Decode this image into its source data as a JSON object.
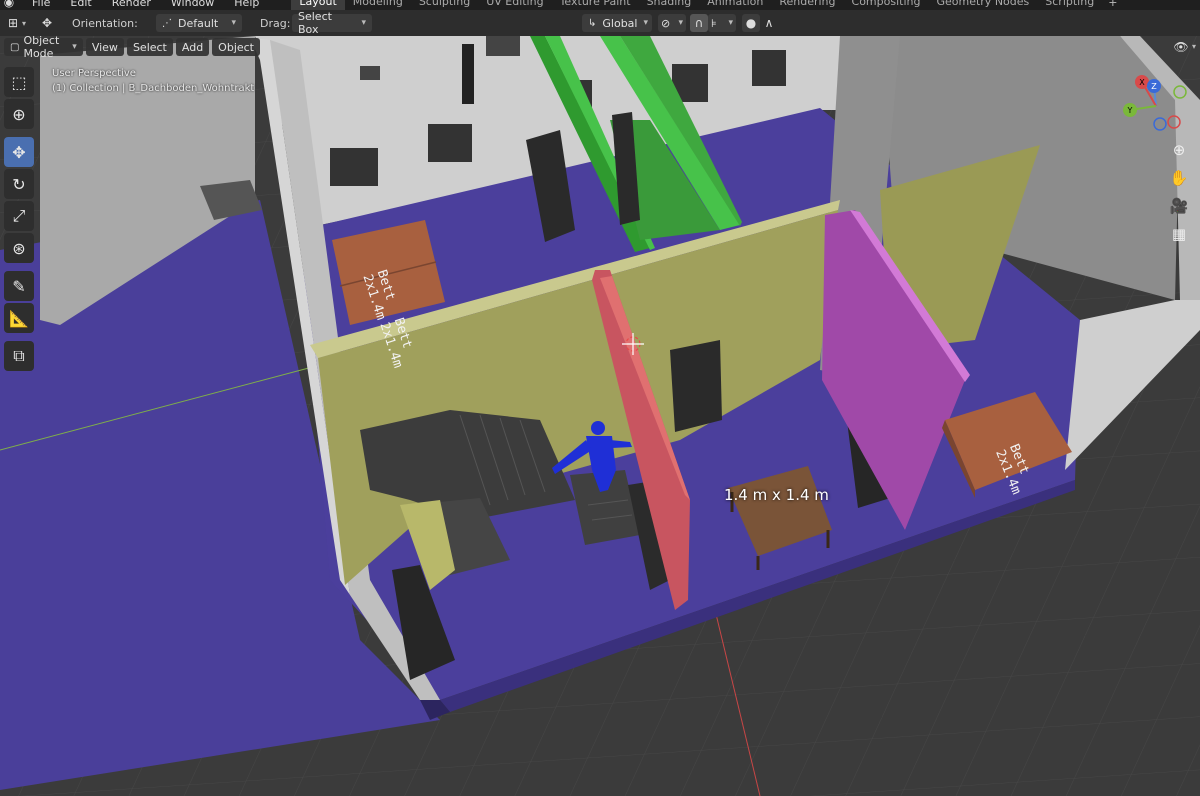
{
  "topbar": {
    "logo_icon": "blender-logo-icon",
    "menus": [
      "File",
      "Edit",
      "Render",
      "Window",
      "Help"
    ],
    "workspaces": [
      "Layout",
      "Modeling",
      "Sculpting",
      "UV Editing",
      "Texture Paint",
      "Shading",
      "Animation",
      "Rendering",
      "Compositing",
      "Geometry Nodes",
      "Scripting"
    ],
    "active_workspace": "Layout",
    "add_label": "+"
  },
  "toolbar": {
    "orientation_label": "Orientation:",
    "orientation_value": "Default",
    "drag_label": "Drag:",
    "drag_value": "Select Box",
    "transform_orientation_value": "Global"
  },
  "viewport_header": {
    "mode": "Object Mode",
    "menus": [
      "View",
      "Select",
      "Add",
      "Object"
    ]
  },
  "overlay": {
    "perspective": "User Perspective",
    "collection": "(1) Collection | B_Dachboden_Wohntrakt"
  },
  "scene": {
    "dimension_text": "1.4 m x 1.4 m",
    "bed_labels": [
      {
        "line1": "Bett",
        "line2": "2x1.4m"
      },
      {
        "line1": "Bett",
        "line2": "2x1.4m"
      },
      {
        "line1": "Bett",
        "line2": "2x1.4m"
      }
    ],
    "colors": {
      "floor": "#4a3f9a",
      "grid_bg": "#3b3b3b",
      "green_wall": "#3fa83f",
      "yellow_wall": "#9a9a55",
      "red_wall": "#c85560",
      "magenta_wall": "#a049a8",
      "bed": "#a8603f",
      "table": "#7a5438",
      "figure": "#1f2fd6",
      "white_wall": "#cfcfcf"
    }
  },
  "gizmo": {
    "x": "X",
    "y": "Y",
    "z": "Z"
  },
  "tools": [
    "select-box-icon",
    "cursor-icon",
    "move-icon",
    "rotate-icon",
    "scale-icon",
    "transform-icon",
    "annotate-icon",
    "measure-icon",
    "add-cube-icon"
  ],
  "nav": [
    "zoom-icon",
    "pan-hand-icon",
    "camera-icon",
    "grid-view-icon"
  ]
}
